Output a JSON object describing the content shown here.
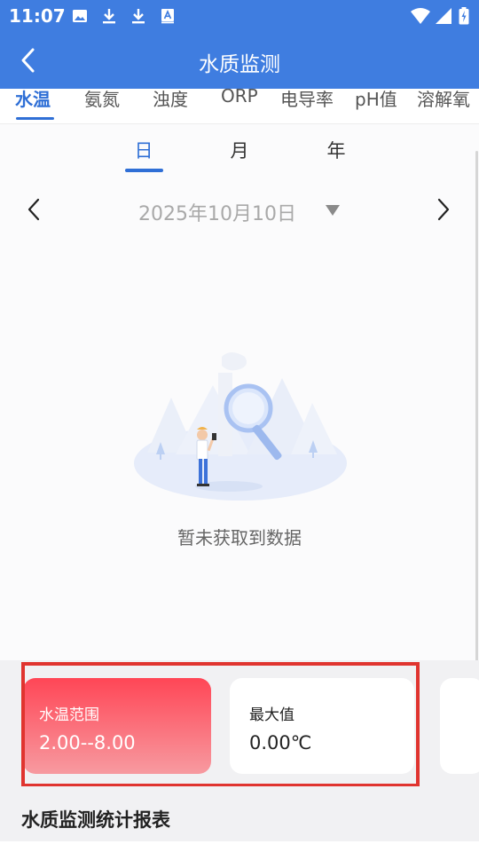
{
  "status_bar": {
    "time": "11:07",
    "left_icons": [
      "image-icon",
      "download-icon",
      "download-icon",
      "a-icon"
    ],
    "right_icons": [
      "wifi-icon",
      "signal-icon",
      "battery-charging-icon"
    ]
  },
  "app_bar": {
    "title": "水质监测",
    "back_icon": "chevron-left-icon",
    "color": "#3f7de0"
  },
  "tabs": [
    {
      "label": "水温",
      "active": true
    },
    {
      "label": "氨氮",
      "active": false
    },
    {
      "label": "浊度",
      "active": false
    },
    {
      "label": "ORP",
      "active": false
    },
    {
      "label": "电导率",
      "active": false
    },
    {
      "label": "pH值",
      "active": false
    },
    {
      "label": "溶解氧",
      "active": false
    }
  ],
  "periods": [
    {
      "label": "日",
      "active": true
    },
    {
      "label": "月",
      "active": false
    },
    {
      "label": "年",
      "active": false
    }
  ],
  "date": {
    "value": "2025年10月10日",
    "prev_icon": "chevron-left-icon",
    "next_icon": "chevron-right-icon",
    "dropdown_icon": "caret-down-icon"
  },
  "empty_state": {
    "text": "暂未获取到数据",
    "illustration": "magnifier-search-illustration"
  },
  "stat_cards": [
    {
      "label": "水温范围",
      "value": "2.00--8.00",
      "style": "red"
    },
    {
      "label": "最大值",
      "value": "0.00℃",
      "style": "white"
    }
  ],
  "report": {
    "title": "水质监测统计报表"
  },
  "colors": {
    "accent": "#2f6fd6",
    "header": "#3f7de0",
    "highlight": "#e0342f",
    "card_red_top": "#ff4656",
    "card_red_bottom": "#f79aa0"
  }
}
